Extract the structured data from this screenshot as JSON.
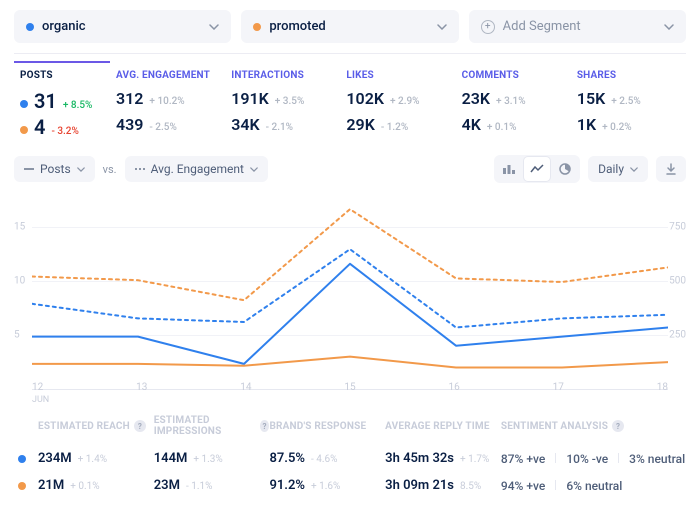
{
  "colors": {
    "organic": "#2f80ed",
    "promoted": "#f2994a"
  },
  "segments": [
    {
      "id": "organic",
      "label": "organic",
      "color": "#2f80ed"
    },
    {
      "id": "promoted",
      "label": "promoted",
      "color": "#f2994a"
    }
  ],
  "add_segment_label": "Add Segment",
  "metrics": {
    "headers": [
      "POSTS",
      "AVG. ENGAGEMENT",
      "INTERACTIONS",
      "LIKES",
      "COMMENTS",
      "SHARES"
    ],
    "rows": [
      {
        "segment": "organic",
        "values": [
          "31",
          "312",
          "191K",
          "102K",
          "23K",
          "15K"
        ],
        "deltas": [
          "+ 8.5%",
          "+ 10.2%",
          "+ 3.5%",
          "+ 2.9%",
          "+ 3.1%",
          "+ 2.5%"
        ],
        "delta_tone": [
          "up",
          "mut",
          "mut",
          "mut",
          "mut",
          "mut"
        ]
      },
      {
        "segment": "promoted",
        "values": [
          "4",
          "439",
          "34K",
          "29K",
          "4K",
          "1K"
        ],
        "deltas": [
          "- 3.2%",
          "- 2.5%",
          "- 2.1%",
          "- 1.2%",
          "+ 0.1%",
          "+ 0.2%"
        ],
        "delta_tone": [
          "dn",
          "mut",
          "mut",
          "mut",
          "mut",
          "mut"
        ]
      }
    ]
  },
  "toolbar": {
    "left_metric": "Posts",
    "vs_label": "vs.",
    "right_metric": "Avg. Engagement",
    "interval": "Daily"
  },
  "chart_data": {
    "type": "line",
    "x": [
      12,
      13,
      14,
      15,
      16,
      17,
      18
    ],
    "x_month": "JUN",
    "y_left": {
      "label": "",
      "ticks": [
        5,
        10,
        15
      ],
      "range": [
        0,
        20
      ]
    },
    "y_right": {
      "label": "",
      "ticks": [
        250,
        500,
        750
      ],
      "range": [
        0,
        1000
      ]
    },
    "series": [
      {
        "name": "organic posts",
        "segment": "organic",
        "axis": "left",
        "style": "solid",
        "color": "#2f80ed",
        "values": [
          4,
          4,
          1,
          12,
          3,
          4,
          5
        ]
      },
      {
        "name": "promoted posts",
        "segment": "promoted",
        "axis": "left",
        "style": "solid",
        "color": "#f2994a",
        "values": [
          1,
          1,
          0.8,
          1.8,
          0.6,
          0.6,
          1.2
        ]
      },
      {
        "name": "organic avg engagement",
        "segment": "organic",
        "axis": "right",
        "style": "dashed",
        "color": "#2f80ed",
        "values": [
          380,
          300,
          280,
          680,
          250,
          300,
          320
        ]
      },
      {
        "name": "promoted avg engagement",
        "segment": "promoted",
        "axis": "right",
        "style": "dashed",
        "color": "#f2994a",
        "values": [
          530,
          510,
          400,
          900,
          520,
          500,
          580
        ]
      }
    ]
  },
  "table": {
    "headers": [
      "ESTIMATED REACH",
      "ESTIMATED IMPRESSIONS",
      "BRAND'S RESPONSE",
      "AVERAGE REPLY TIME",
      "SENTIMENT ANALYSIS"
    ],
    "header_help": [
      true,
      true,
      false,
      false,
      true
    ],
    "rows": [
      {
        "segment": "organic",
        "reach": {
          "v": "234M",
          "d": "+ 1.4%"
        },
        "impr": {
          "v": "144M",
          "d": "+ 1.3%"
        },
        "resp": {
          "v": "87.5%",
          "d": "- 4.6%"
        },
        "reply": {
          "v": "3h 45m 32s",
          "d": "+ 1.7%"
        },
        "sent": {
          "pos": "87% +ve",
          "neg": "10% -ve",
          "neu": "3% neutral"
        }
      },
      {
        "segment": "promoted",
        "reach": {
          "v": "21M",
          "d": "+ 0.1%"
        },
        "impr": {
          "v": "23M",
          "d": "- 1.1%"
        },
        "resp": {
          "v": "91.2%",
          "d": "+ 1.6%"
        },
        "reply": {
          "v": "3h 09m 21s",
          "d": "8.5%"
        },
        "sent": {
          "pos": "94% +ve",
          "neg": "",
          "neu": "6% neutral"
        }
      }
    ]
  }
}
